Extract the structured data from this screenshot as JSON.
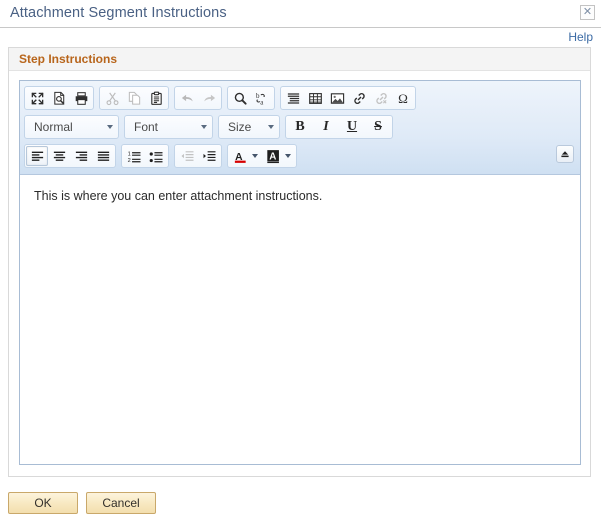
{
  "window": {
    "title": "Attachment Segment Instructions",
    "close_label": "✕",
    "close_icon": "close-icon"
  },
  "help": {
    "label": "Help"
  },
  "groupbox": {
    "title": "Step Instructions"
  },
  "editor": {
    "content": "This is where you can enter attachment instructions.",
    "collapse_icon": "collapse-toolbar-icon",
    "toolbar": {
      "row1": [
        {
          "name": "maximize-icon",
          "title": "Maximize",
          "enabled": true
        },
        {
          "name": "preview-icon",
          "title": "Preview",
          "enabled": true
        },
        {
          "name": "print-icon",
          "title": "Print",
          "enabled": true
        },
        {
          "name": "cut-icon",
          "title": "Cut",
          "enabled": false
        },
        {
          "name": "copy-icon",
          "title": "Copy",
          "enabled": false
        },
        {
          "name": "paste-icon",
          "title": "Paste",
          "enabled": true
        },
        {
          "name": "undo-icon",
          "title": "Undo",
          "enabled": false
        },
        {
          "name": "redo-icon",
          "title": "Redo",
          "enabled": false
        },
        {
          "name": "find-icon",
          "title": "Find",
          "enabled": true
        },
        {
          "name": "replace-icon",
          "title": "Replace",
          "enabled": true
        },
        {
          "name": "blockquote-icon",
          "title": "Block Quote",
          "enabled": true
        },
        {
          "name": "table-icon",
          "title": "Table",
          "enabled": true
        },
        {
          "name": "image-icon",
          "title": "Image",
          "enabled": true
        },
        {
          "name": "link-icon",
          "title": "Link",
          "enabled": true
        },
        {
          "name": "unlink-icon",
          "title": "Unlink",
          "enabled": false
        },
        {
          "name": "special-character-icon",
          "title": "Insert Special Character",
          "enabled": true
        }
      ],
      "paragraph_format": "Normal",
      "font_family": "Font",
      "font_size": "Size",
      "bold_label": "B",
      "italic_label": "I",
      "underline_label": "U",
      "strike_label": "S",
      "row3": [
        {
          "name": "align-left-icon",
          "title": "Align Left",
          "enabled": true,
          "active": true
        },
        {
          "name": "align-center-icon",
          "title": "Center",
          "enabled": true,
          "active": false
        },
        {
          "name": "align-right-icon",
          "title": "Align Right",
          "enabled": true,
          "active": false
        },
        {
          "name": "align-justify-icon",
          "title": "Justify",
          "enabled": true,
          "active": false
        },
        {
          "name": "numbered-list-icon",
          "title": "Insert/Remove Numbered List",
          "enabled": true,
          "active": false
        },
        {
          "name": "bulleted-list-icon",
          "title": "Insert/Remove Bulleted List",
          "enabled": true,
          "active": false
        },
        {
          "name": "outdent-icon",
          "title": "Decrease Indent",
          "enabled": false,
          "active": false
        },
        {
          "name": "indent-icon",
          "title": "Increase Indent",
          "enabled": true,
          "active": false
        }
      ],
      "text_color_label": "A",
      "bg_color_label": "A"
    }
  },
  "footer": {
    "ok_label": "OK",
    "cancel_label": "Cancel"
  },
  "colors": {
    "title_text": "#4a6184",
    "group_title": "#b8651b",
    "link": "#3c6ba5",
    "toolbar_top": "#eef4fb",
    "toolbar_bottom": "#cfe0f2",
    "editor_border": "#a8bcd4",
    "button_border": "#c9a86a",
    "button_face": "#f8e9c2",
    "text_color_swatch": "#d60000"
  }
}
